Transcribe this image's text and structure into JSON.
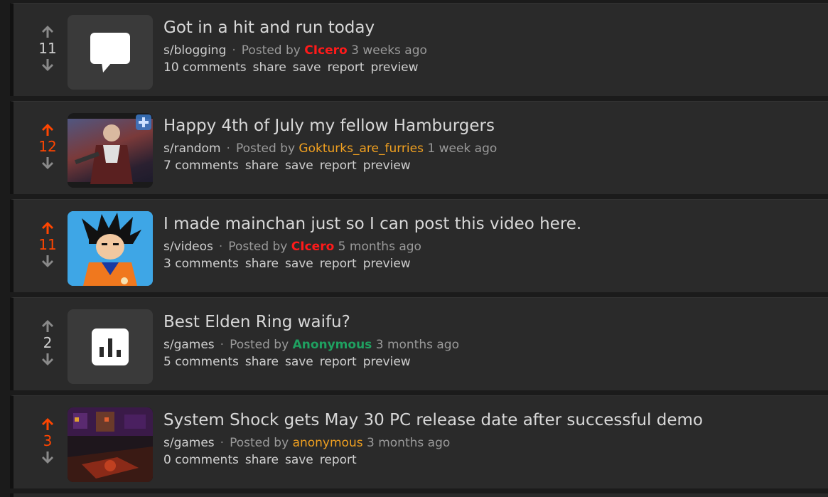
{
  "posts": [
    {
      "score": "11",
      "vote_state": "none",
      "thumb": "text-post-icon",
      "title": "Got in a hit and run today",
      "sub": "s/blogging",
      "posted_by": "Posted by",
      "author": "CIcero",
      "author_color": "#ff1a1a",
      "time": "3 weeks ago",
      "comments": "10 comments",
      "actions": [
        "share",
        "save",
        "report",
        "preview"
      ]
    },
    {
      "score": "12",
      "vote_state": "up",
      "thumb": "image-thumbnail",
      "title": "Happy 4th of July my fellow Hamburgers",
      "sub": "s/random",
      "posted_by": "Posted by",
      "author": "Gokturks_are_furries",
      "author_color": "#f0a020",
      "time": "1 week ago",
      "comments": "7 comments",
      "actions": [
        "share",
        "save",
        "report",
        "preview"
      ]
    },
    {
      "score": "11",
      "vote_state": "up",
      "thumb": "video-thumbnail",
      "title": "I made mainchan just so I can post this video here.",
      "sub": "s/videos",
      "posted_by": "Posted by",
      "author": "CIcero",
      "author_color": "#ff1a1a",
      "time": "5 months ago",
      "comments": "3 comments",
      "actions": [
        "share",
        "save",
        "report",
        "preview"
      ]
    },
    {
      "score": "2",
      "vote_state": "none",
      "thumb": "poll-icon",
      "title": "Best Elden Ring waifu?",
      "sub": "s/games",
      "posted_by": "Posted by",
      "author": "Anonymous",
      "author_color": "#1fa060",
      "time": "3 months ago",
      "comments": "5 comments",
      "actions": [
        "share",
        "save",
        "report",
        "preview"
      ]
    },
    {
      "score": "3",
      "vote_state": "up",
      "thumb": "link-thumbnail",
      "title": "System Shock gets May 30 PC release date after successful demo",
      "sub": "s/games",
      "posted_by": "Posted by",
      "author": "anonymous",
      "author_color": "#f0a020",
      "time": "3 months ago",
      "comments": "0 comments",
      "actions": [
        "share",
        "save",
        "report"
      ]
    }
  ],
  "colors": {
    "upvote": "#ff4500",
    "neutral_arrow": "#8a8a8a",
    "card_bg": "#2a2a2a",
    "page_bg": "#1b1b1b"
  }
}
